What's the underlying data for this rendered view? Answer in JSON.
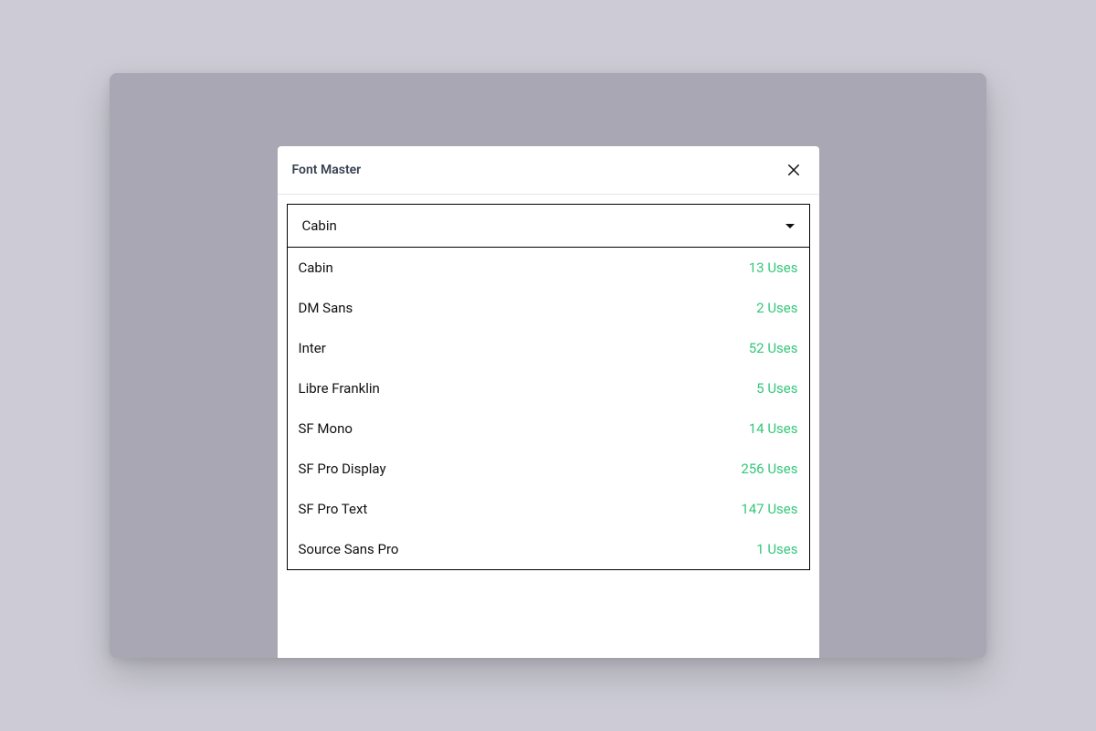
{
  "modal": {
    "title": "Font Master",
    "uses_suffix": "Uses"
  },
  "select": {
    "value": "Cabin"
  },
  "options": [
    {
      "name": "Cabin",
      "uses": 13
    },
    {
      "name": "DM Sans",
      "uses": 2
    },
    {
      "name": "Inter",
      "uses": 52
    },
    {
      "name": "Libre Franklin",
      "uses": 5
    },
    {
      "name": "SF Mono",
      "uses": 14
    },
    {
      "name": "SF Pro Display",
      "uses": 256
    },
    {
      "name": "SF Pro Text",
      "uses": 147
    },
    {
      "name": "Source Sans Pro",
      "uses": 1
    }
  ]
}
